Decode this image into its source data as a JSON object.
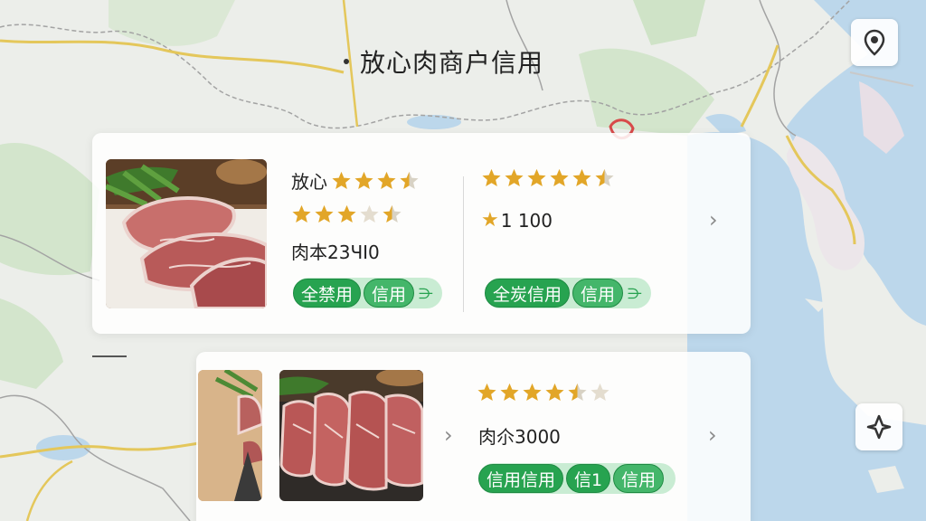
{
  "header": {
    "title": "放心肉商户信用"
  },
  "map": {
    "colors": {
      "land": "#eceeea",
      "sea": "#b9d5ea",
      "green": "#cfe3c7",
      "road": "#e3c55a",
      "border": "#9a9a9a",
      "urban": "#e8dfe6"
    }
  },
  "controls": {
    "location_icon": "location-pin-icon",
    "compass_icon": "compass-icon"
  },
  "cards": [
    {
      "left": {
        "line1": "放心",
        "line1_stars": 3.5,
        "line2_stars": 3.5,
        "line3": "肉本23ЧІ0",
        "badges": [
          "全禁用",
          "信用"
        ],
        "badge_tail": "⋺"
      },
      "right": {
        "stars": 5.5,
        "score_star": "★",
        "score": "1 100",
        "badges": [
          "全炭信用",
          "信用"
        ],
        "badge_tail": "⋺"
      },
      "chevron": "›"
    },
    {
      "stars": 4.5,
      "text": "肉尒3000",
      "badges": [
        "信用信用",
        "信1",
        "信用"
      ],
      "chevron_left": "›",
      "chevron_right": "›"
    }
  ],
  "colors": {
    "star": "#e2a628",
    "star_empty": "#d8d2c4",
    "badge": "#27a350",
    "badge_bg": "#c9ecd3"
  }
}
